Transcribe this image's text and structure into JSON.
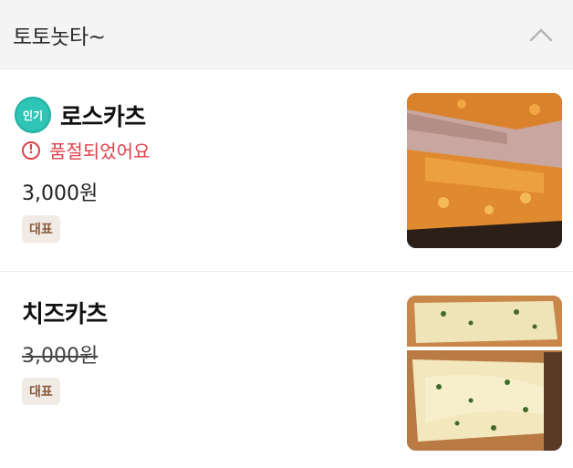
{
  "section": {
    "title": "토토놋타~",
    "toggle_icon": "chevron-up-icon"
  },
  "items": [
    {
      "badge": "인기",
      "name": "로스카츠",
      "status": "품절되었어요",
      "status_icon": "exclamation-circle-icon",
      "price": "3,000원",
      "tag": "대표",
      "photo": "pork-loin-katsu-photo"
    },
    {
      "name": "치즈카츠",
      "price": "3,000원",
      "tag": "대표",
      "photo": "cheese-katsu-photo"
    }
  ],
  "colors": {
    "header_bg": "#f4f4f4",
    "badge_teal": "#2ec4b6",
    "soldout_red": "#e0414a",
    "tag_bg": "#f1ebe6",
    "tag_text": "#8a5a3c"
  }
}
